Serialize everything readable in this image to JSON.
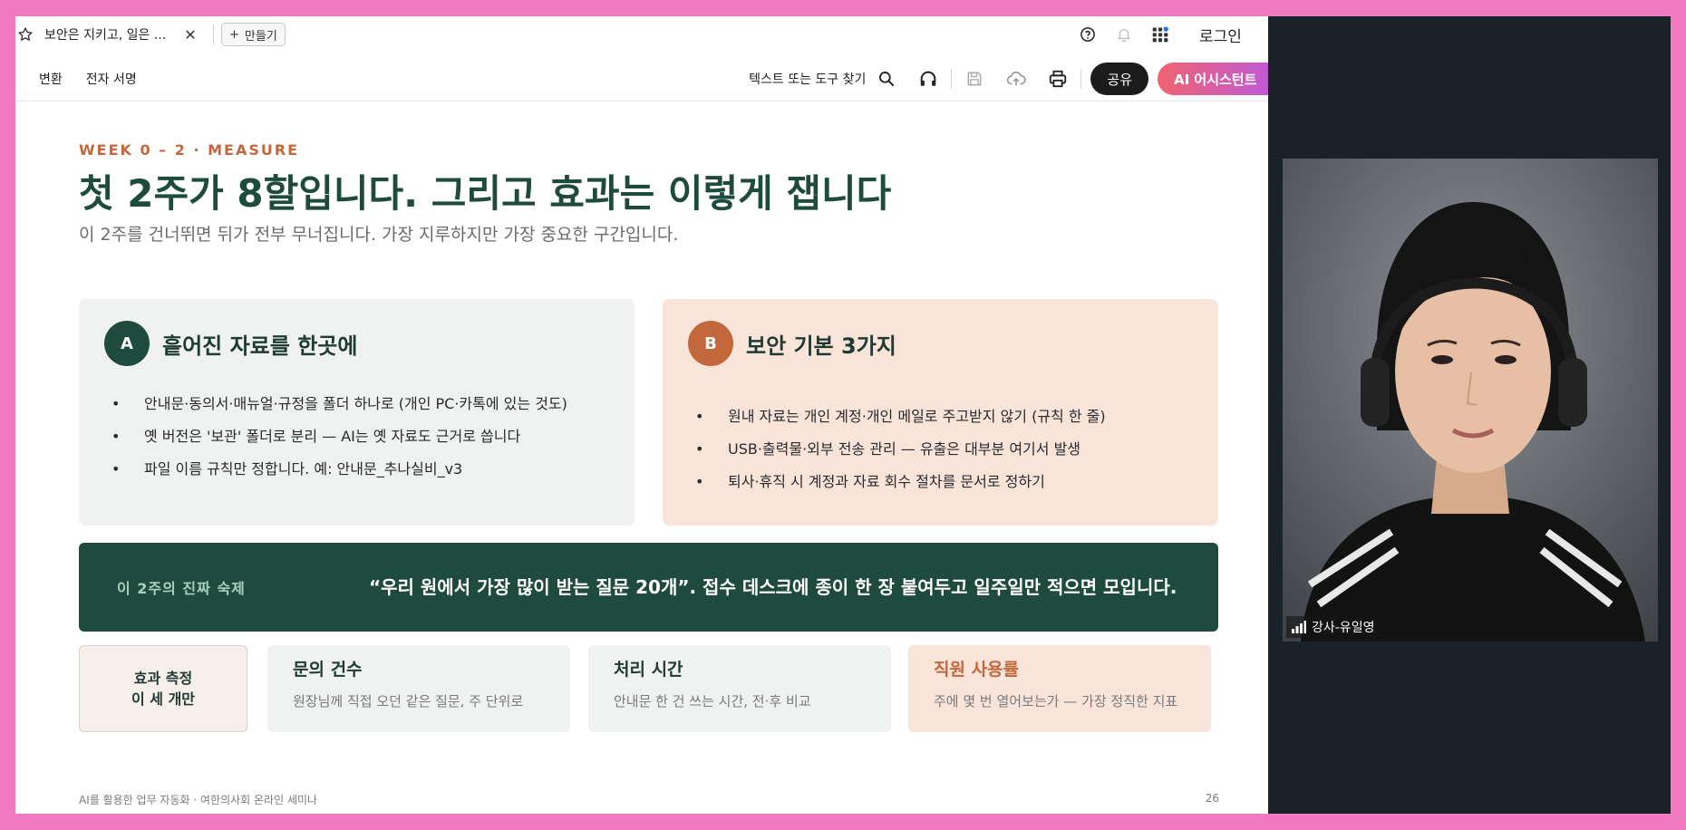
{
  "browser": {
    "tab_title": "보안은 지키고, 일은 ...",
    "create_label": "만들기",
    "login_label": "로그인"
  },
  "toolbar": {
    "menu": [
      "변환",
      "전자 서명"
    ],
    "find_tools": "텍스트 또는 도구 찾기",
    "share_label": "공유",
    "ai_label": "AI 어시스턴트"
  },
  "slide": {
    "eyebrow": "WEEK 0 – 2 · MEASURE",
    "headline": "첫 2주가 8할입니다. 그리고 효과는 이렇게 잽니다",
    "subline": "이 2주를 건너뛰면 뒤가 전부 무너집니다. 가장 지루하지만 가장 중요한 구간입니다.",
    "card_a": {
      "badge": "A",
      "title": "흩어진 자료를 한곳에",
      "bullets": [
        "안내문·동의서·매뉴얼·규정을 폴더 하나로 (개인 PC·카톡에 있는 것도)",
        "옛 버전은 '보관' 폴더로 분리 — AI는 옛 자료도 근거로 씁니다",
        "파일 이름 규칙만 정합니다. 예: 안내문_추나실비_v3"
      ]
    },
    "card_b": {
      "badge": "B",
      "title": "보안 기본 3가지",
      "bullets": [
        "원내 자료는 개인 계정·개인 메일로 주고받지 않기 (규칙 한 줄)",
        "USB·출력물·외부 전송 관리 — 유출은 대부분 여기서 발생",
        "퇴사·휴직 시 계정과 자료 회수 절차를 문서로 정하기"
      ]
    },
    "banner": {
      "label": "이 2주의 진짜 숙제",
      "text": "“우리 원에서 가장 많이 받는 질문 20개”. 접수 데스크에 종이 한 장 붙여두고 일주일만 적으면 모입니다."
    },
    "metrics": {
      "lead_line1": "효과 측정",
      "lead_line2": "이 세 개만",
      "items": [
        {
          "title": "문의 건수",
          "desc": "원장님께 직접 오던 같은 질문, 주 단위로"
        },
        {
          "title": "처리 시간",
          "desc": "안내문 한 건 쓰는 시간, 전·후 비교"
        },
        {
          "title": "직원 사용률",
          "desc": "주에 몇 번 열어보는가 — 가장 정직한 지표"
        }
      ]
    },
    "footer_left": "AI를 활용한 업무 자동화 · 여한의사회 온라인 세미나",
    "page_number": "26"
  },
  "video": {
    "name": "강사-유일영"
  },
  "colors": {
    "accent_green": "#1f4a3e",
    "accent_orange": "#c2683c",
    "frame_pink": "#f27ac0"
  }
}
